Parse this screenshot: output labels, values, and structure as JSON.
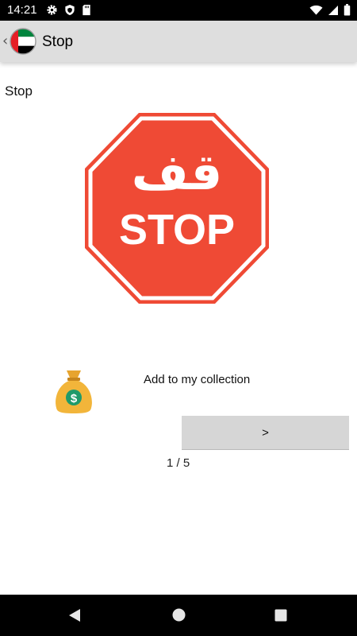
{
  "status_bar": {
    "time": "14:21",
    "left_icons": [
      "gear-icon",
      "shield-icon",
      "sd-card-icon"
    ],
    "right_icons": [
      "wifi-icon",
      "signal-icon",
      "battery-icon"
    ]
  },
  "app_bar": {
    "title": "Stop",
    "back_icon": "chevron-left-icon",
    "avatar_icon": "uae-flag-icon"
  },
  "content": {
    "title": "Stop",
    "sign": {
      "arabic_text": "قف",
      "english_text": "STOP",
      "color": "#ef4a35"
    },
    "collection_icon": "money-bag-icon",
    "add_label": "Add to my collection",
    "next_label": ">",
    "page_counter": "1 / 5"
  },
  "nav_bar": {
    "icons": [
      "back-triangle-icon",
      "home-circle-icon",
      "recents-square-icon"
    ]
  }
}
